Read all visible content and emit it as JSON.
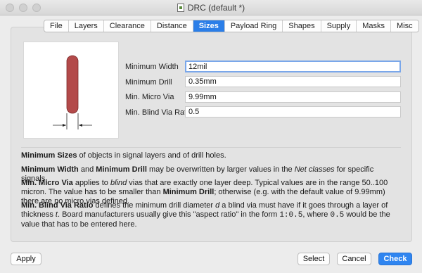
{
  "window": {
    "title": "DRC (default *)"
  },
  "tabs": [
    {
      "label": "File"
    },
    {
      "label": "Layers"
    },
    {
      "label": "Clearance"
    },
    {
      "label": "Distance"
    },
    {
      "label": "Sizes",
      "active": true
    },
    {
      "label": "Payload Ring"
    },
    {
      "label": "Shapes"
    },
    {
      "label": "Supply"
    },
    {
      "label": "Masks"
    },
    {
      "label": "Misc"
    }
  ],
  "form": {
    "minimum_width_label": "Minimum Width",
    "minimum_width_value": "12mil",
    "minimum_drill_label": "Minimum Drill",
    "minimum_drill_value": "0.35mm",
    "min_micro_via_label": "Min. Micro Via",
    "min_micro_via_value": "9.99mm",
    "min_blind_via_ratio_label": "Min. Blind Via Ratio",
    "min_blind_via_ratio_value": "0.5"
  },
  "description": {
    "p1": {
      "b1": "Minimum Sizes",
      "t1": " of objects in signal layers and of drill holes."
    },
    "p2": {
      "b1": "Minimum Width",
      "t1": " and ",
      "b2": "Minimum Drill",
      "t2": " may be overwritten by larger values in the ",
      "i1": "Net classes",
      "t3": " for specific signals."
    },
    "p3": {
      "b1": "Min. Micro Via",
      "t1": " applies to ",
      "i1": "blind",
      "t2": " vias that are exactly one layer deep. Typical values are in the range 50..100 micron. The value has to be smaller than ",
      "b2": "Minimum Drill",
      "t3": "; otherwise (e.g. with the default value of 9.99mm) there are no micro vias defined."
    },
    "p4": {
      "b1": "Min. Blind Via Ratio",
      "t1": " defines the minimum drill diameter ",
      "i1": "d",
      "t2": " a blind via must have if it goes through a layer of thickness ",
      "i2": "t",
      "t3": ". Board manufacturers usually give this \"aspect ratio\" in the form ",
      "m1": "1:0.5",
      "t4": ", where ",
      "m2": "0.5",
      "t5": " would be the value that has to be entered here."
    }
  },
  "buttons": {
    "apply": "Apply",
    "select": "Select",
    "cancel": "Cancel",
    "check": "Check"
  },
  "colors": {
    "trace": "#b34a4a",
    "accent": "#2f85f0"
  }
}
